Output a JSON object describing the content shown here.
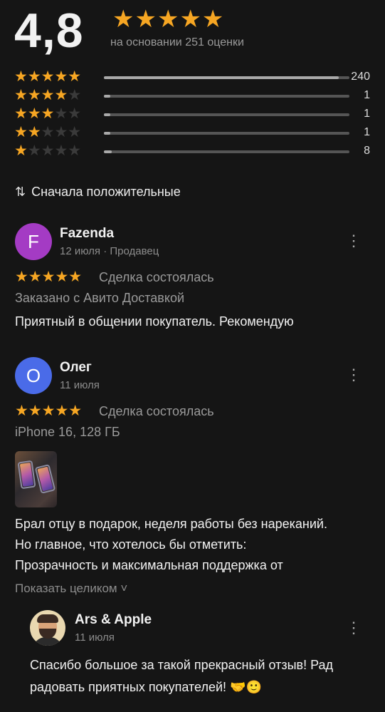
{
  "summary": {
    "rating": "4,8",
    "stars": "★★★★★",
    "based_on": "на основании 251 оценки"
  },
  "distribution": [
    {
      "stars_on": "★★★★★",
      "stars_off": "",
      "count": "240",
      "fraction": 0.956
    },
    {
      "stars_on": "★★★★",
      "stars_off": "★",
      "count": "1",
      "fraction": 0.012
    },
    {
      "stars_on": "★★★",
      "stars_off": "★★",
      "count": "1",
      "fraction": 0.012
    },
    {
      "stars_on": "★★",
      "stars_off": "★★★",
      "count": "1",
      "fraction": 0.012
    },
    {
      "stars_on": "★",
      "stars_off": "★★★★",
      "count": "8",
      "fraction": 0.032
    }
  ],
  "sort": {
    "icon": "sort-arrows-icon",
    "glyph": "⇅",
    "label": "Сначала положительные"
  },
  "reviews": [
    {
      "avatar_letter": "F",
      "avatar_color": "#a43bc4",
      "name": "Fazenda",
      "meta": "12 июля · Продавец",
      "stars": "★★★★★",
      "deal": "Сделка состоялась",
      "sub": "Заказано с Авито Доставкой",
      "text": "Приятный в общении покупатель. Рекомендую"
    },
    {
      "avatar_letter": "О",
      "avatar_color": "#4a6be8",
      "name": "Олег",
      "meta": "11 июля",
      "stars": "★★★★★",
      "deal": "Сделка состоялась",
      "sub": "iPhone 16, 128 ГБ",
      "text_lines": [
        "Брал отцу в подарок, неделя работы без нареканий.",
        "Но главное, что хотелось бы отметить:",
        "Прозрачность и максимальная поддержка от"
      ],
      "show_full": "Показать целиком ˅"
    }
  ],
  "reply": {
    "name": "Ars & Apple",
    "date": "11 июля",
    "text_lines": [
      "Спасибо большое за такой прекрасный отзыв! Рад",
      "радовать приятных покупателей! 🤝🙂"
    ]
  },
  "more_glyph": "⋮",
  "colors": {
    "background": "#151515",
    "star": "#f6a623",
    "muted": "#8c8c8c"
  }
}
